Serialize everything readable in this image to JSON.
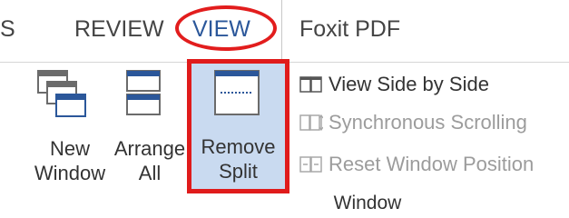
{
  "tabs": {
    "s": "S",
    "review": "REVIEW",
    "view": "VIEW",
    "foxit": "Foxit PDF"
  },
  "ribbon": {
    "buttons": [
      {
        "label_line1": "New",
        "label_line2": "Window",
        "icon": "new-window-icon"
      },
      {
        "label_line1": "Arrange",
        "label_line2": "All",
        "icon": "arrange-all-icon"
      },
      {
        "label_line1": "Remove",
        "label_line2": "Split",
        "icon": "remove-split-icon"
      }
    ],
    "side_items": [
      {
        "label": "View Side by Side",
        "icon": "view-side-by-side-icon"
      },
      {
        "label": "Synchronous Scrolling",
        "icon": "synchronous-scrolling-icon"
      },
      {
        "label": "Reset Window Position",
        "icon": "reset-window-position-icon"
      }
    ],
    "group_label": "Window"
  },
  "colors": {
    "active_tab": "#2b579a",
    "highlight_red": "#e01b1b",
    "selected_bg": "#c9daf0",
    "disabled_text": "#9c9c9c"
  }
}
